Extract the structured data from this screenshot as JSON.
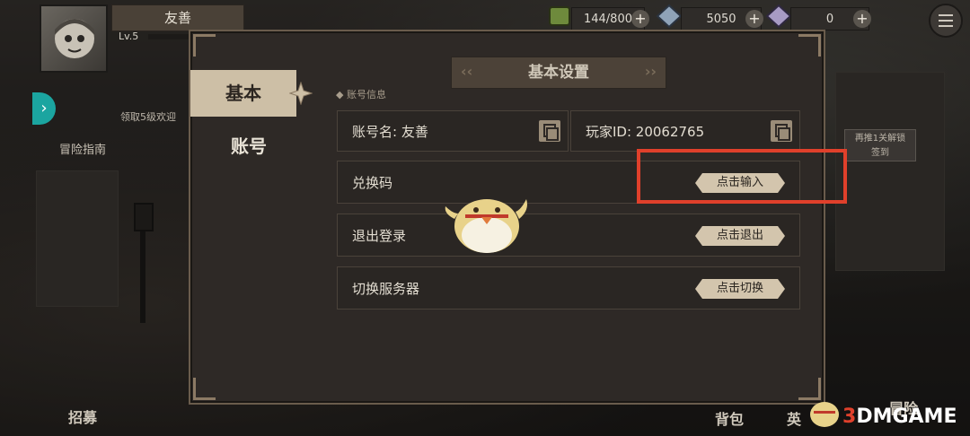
{
  "player": {
    "name": "友善",
    "level": "Lv.5"
  },
  "resources": {
    "stamina": "144/800",
    "crystal": "5050",
    "gem": "0"
  },
  "side": {
    "task_text": "领取5级欢迎",
    "guide_label": "冒险指南",
    "right_tip": "再推1关解锁\n签到"
  },
  "bottom": {
    "recruit": "招募",
    "bag": "背包",
    "hero": "英",
    "adventure": "冒险"
  },
  "dialog": {
    "title": "基本设置",
    "tabs": [
      {
        "label": "基本"
      },
      {
        "label": "账号"
      }
    ],
    "section_label": "账号信息",
    "account_name": "账号名: 友善",
    "player_id": "玩家ID: 20062765",
    "rows": [
      {
        "label": "兑换码",
        "action": "点击输入"
      },
      {
        "label": "退出登录",
        "action": "点击退出"
      },
      {
        "label": "切换服务器",
        "action": "点击切换"
      }
    ]
  },
  "watermark": "3DMGAME",
  "colors": {
    "highlight": "#e0402b",
    "accent": "#d3c5ad"
  }
}
